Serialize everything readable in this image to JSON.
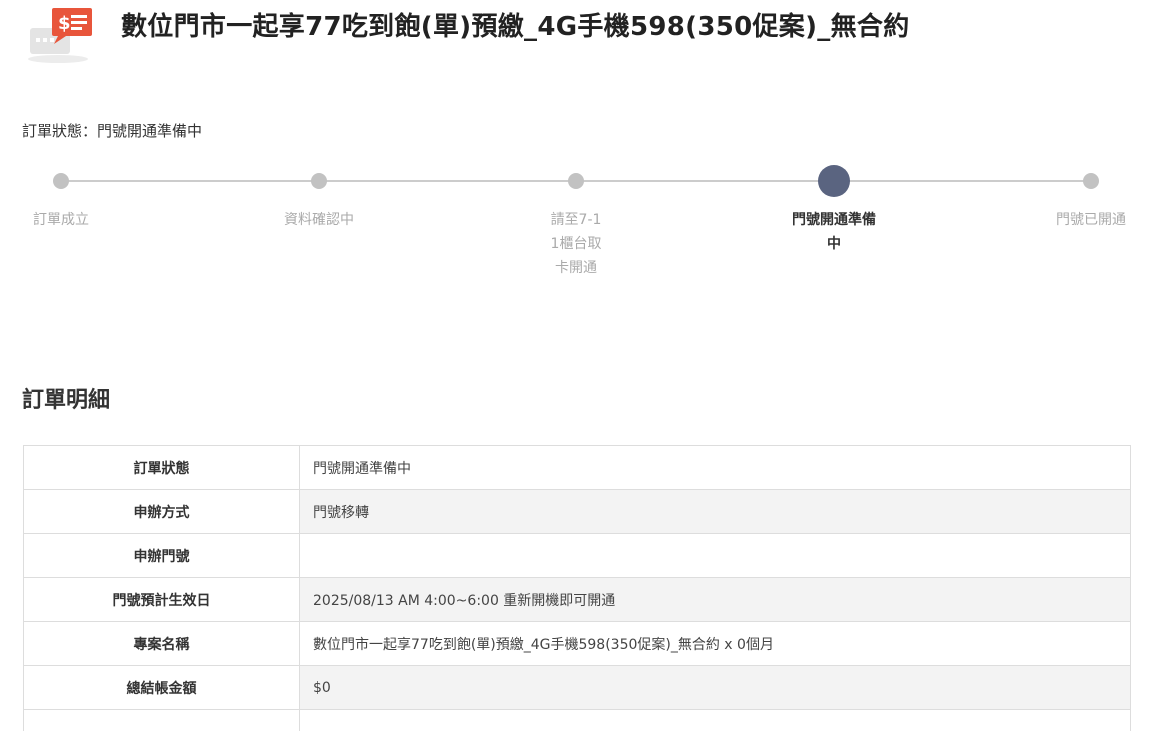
{
  "header": {
    "icon": "receipt-dollar-icon",
    "title": "數位門市一起享77吃到飽(單)預繳_4G手機598(350促案)_無合約"
  },
  "status": {
    "label": "訂單狀態：",
    "value": "門號開通準備中"
  },
  "stepper": {
    "steps": [
      {
        "label": "訂單成立",
        "active": false
      },
      {
        "label": "資料確認中",
        "active": false
      },
      {
        "label": "請至7-11櫃台取卡開通",
        "active": false
      },
      {
        "label": "門號開通準備中",
        "active": true
      },
      {
        "label": "門號已開通",
        "active": false
      }
    ]
  },
  "details": {
    "title": "訂單明細",
    "rows": [
      {
        "label": "訂單狀態",
        "value": "門號開通準備中"
      },
      {
        "label": "申辦方式",
        "value": "門號移轉"
      },
      {
        "label": "申辦門號",
        "value": ""
      },
      {
        "label": "門號預計生效日",
        "value": "2025/08/13 AM 4:00~6:00 重新開機即可開通"
      },
      {
        "label": "專案名稱",
        "value": "數位門市一起享77吃到飽(單)預繳_4G手機598(350促案)_無合約 x 0個月"
      },
      {
        "label": "總結帳金額",
        "value": "$0"
      }
    ]
  },
  "colors": {
    "accent": "#e8553b",
    "active_step": "#5a6480",
    "inactive_step": "#c2c2c2"
  }
}
